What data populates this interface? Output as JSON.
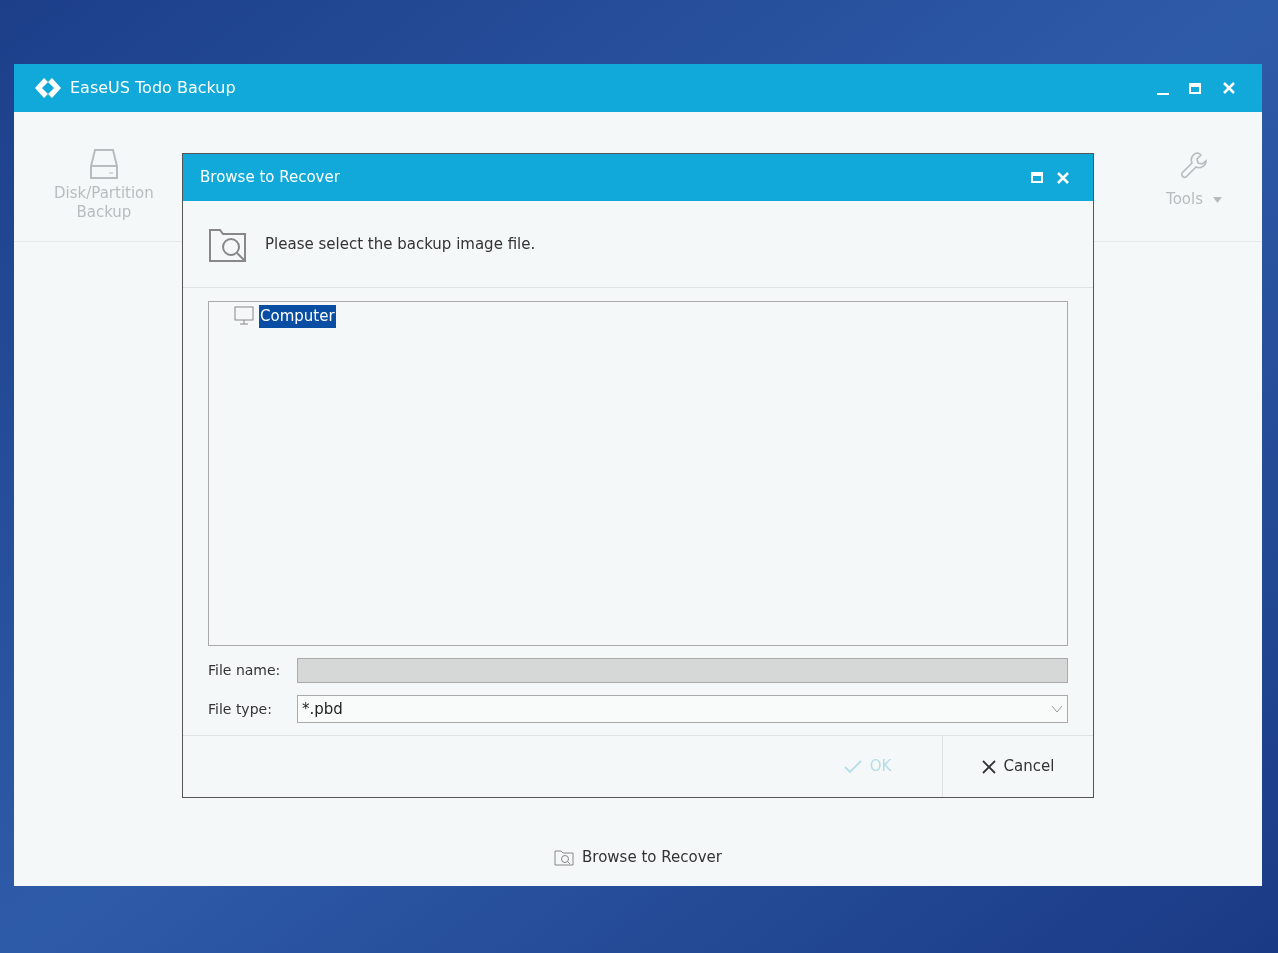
{
  "window": {
    "title": "EaseUS Todo Backup"
  },
  "toolbar": [
    {
      "kind": "disk",
      "label": "Disk/Partition\nBackup",
      "disabled": true
    },
    {
      "kind": "tools",
      "label": "Tools",
      "disabled": true
    }
  ],
  "dialog": {
    "title": "Browse to Recover",
    "prompt": "Please select the backup image file.",
    "tree": [
      {
        "label": "Computer",
        "selected": true
      }
    ],
    "file_name": {
      "label": "File name:",
      "disabled": true
    },
    "file_type": {
      "label": "File type:",
      "value": "*.pbd"
    },
    "buttons": [
      {
        "kind": "ok",
        "label": "OK",
        "disabled": true
      },
      {
        "kind": "cancel",
        "label": "Cancel",
        "disabled": false
      }
    ]
  },
  "bottom_link": "Browse to Recover"
}
